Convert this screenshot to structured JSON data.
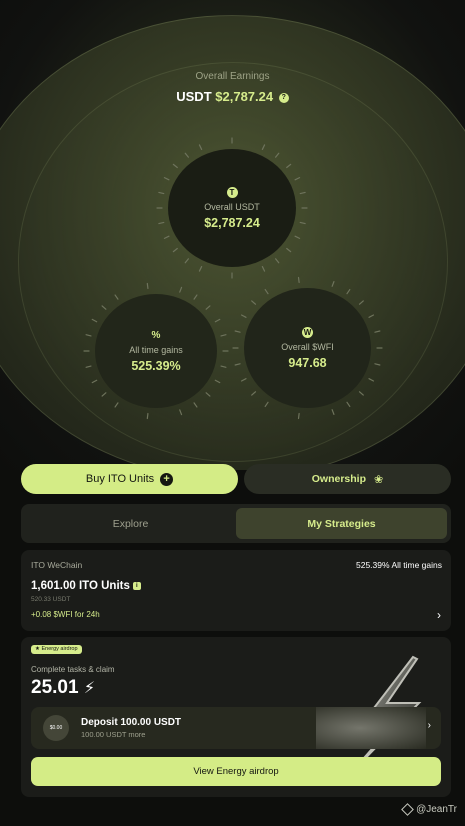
{
  "hero": {
    "title": "Overall Earnings",
    "currency": "USDT",
    "amount": "$2,787.24",
    "help_icon": "question-icon"
  },
  "bubbles": {
    "main": {
      "icon": "tether-icon",
      "icon_char": "T",
      "label": "Overall USDT",
      "value": "$2,787.24"
    },
    "left": {
      "icon": "percent-icon",
      "icon_char": "%",
      "label": "All time gains",
      "value": "525.39%"
    },
    "right": {
      "icon": "wfi-icon",
      "icon_char": "W",
      "label": "Overall $WFI",
      "value": "947.68"
    }
  },
  "actions": {
    "buy_label": "Buy ITO Units",
    "ownership_label": "Ownership"
  },
  "tabs": [
    {
      "label": "Explore",
      "active": false
    },
    {
      "label": "My Strategies",
      "active": true
    }
  ],
  "strategy": {
    "name": "ITO WeChain",
    "gain": "525.39% All time gains",
    "units": "1,601.00 ITO Units",
    "usdt": "520.33 USDT",
    "wfi": "+0.08 $WFI for 24h"
  },
  "energy": {
    "badge": "Energy airdrop",
    "subtitle": "Complete tasks & claim",
    "value": "25.01",
    "deposit": {
      "coin_label": "$0.00",
      "title": "Deposit 100.00 USDT",
      "subtitle": "100.00 USDT more"
    },
    "cta": "View Energy airdrop"
  },
  "watermark": "@JeanTr",
  "colors": {
    "accent": "#d6ec8c",
    "background": "#0d0e0c",
    "card": "#1b1c19"
  }
}
